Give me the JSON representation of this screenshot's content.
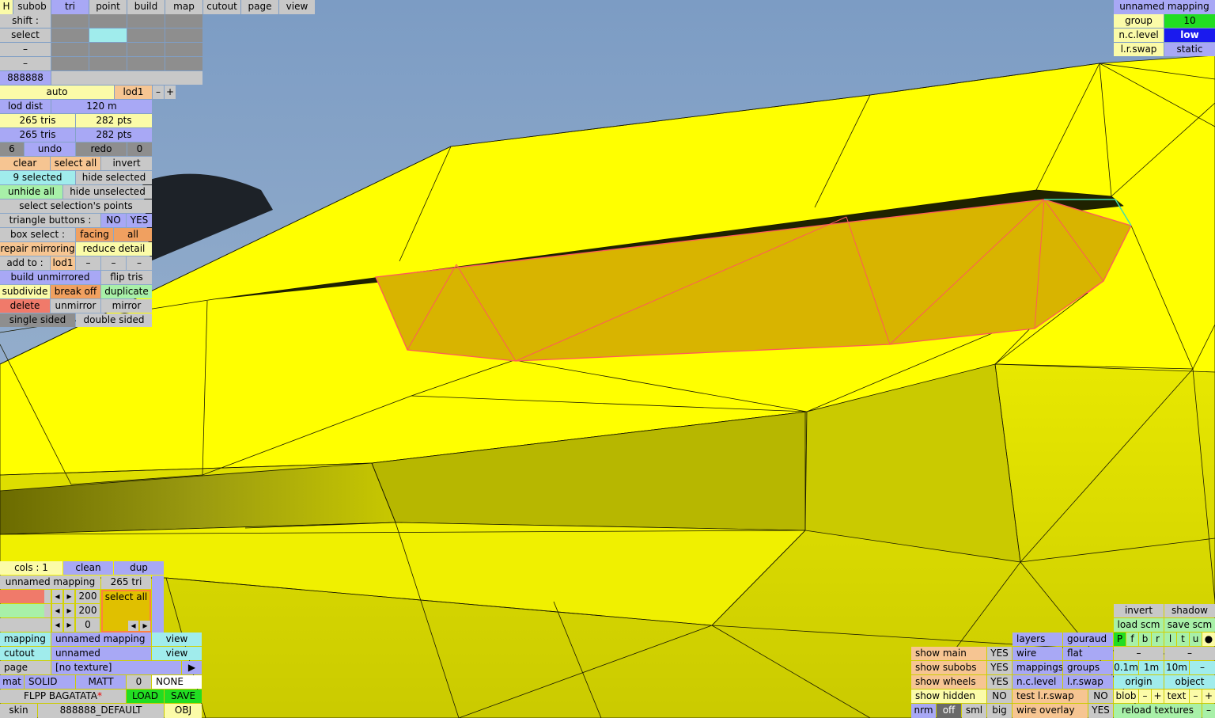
{
  "colors": {
    "mesh": "#ffff00",
    "selection_fill": "#d8b200",
    "selection_edge": "#ff5a5a",
    "highlight_edge": "#44ddaa",
    "sky": "#8fa9c6"
  },
  "top_menu": {
    "h": "H",
    "subob": "subob",
    "tri": "tri",
    "point": "point",
    "build": "build",
    "map": "map",
    "cutout": "cutout",
    "page": "page",
    "view": "view"
  },
  "left": {
    "shift": "shift :",
    "select": "select",
    "dash1": "–",
    "dash2": "–",
    "color": "888888",
    "auto": "auto",
    "lod": "lod1",
    "minus": "–",
    "plus": "+",
    "lod_dist": "lod dist",
    "lod_dist_val": "120 m",
    "tris1": "265 tris",
    "pts1": "282 pts",
    "tris2": "265 tris",
    "pts2": "282 pts",
    "undo_n": "6",
    "undo": "undo",
    "redo": "redo",
    "redo_n": "0",
    "clear": "clear",
    "select_all": "select all",
    "invert": "invert",
    "selected": "9 selected",
    "hide_selected": "hide selected",
    "unhide_all": "unhide all",
    "hide_unselected": "hide unselected",
    "select_points": "select selection's points",
    "triangle_buttons": "triangle buttons :",
    "no": "NO",
    "yes": "YES",
    "box_select": "box select :",
    "facing": "facing",
    "all": "all",
    "repair_mirroring": "repair mirroring",
    "reduce_detail": "reduce detail",
    "add_to": "add to :",
    "add_lod": "lod1",
    "d1": "–",
    "d2": "–",
    "d3": "–",
    "build_unmirrored": "build unmirrored",
    "flip_tris": "flip tris",
    "subdivide": "subdivide",
    "break_off": "break off",
    "duplicate": "duplicate",
    "delete": "delete",
    "unmirror": "unmirror",
    "mirror": "mirror",
    "single_sided": "single sided",
    "double_sided": "double sided"
  },
  "bottom_left": {
    "cols": "cols : 1",
    "clean": "clean",
    "dup": "dup",
    "mapping_name": "unnamed mapping",
    "tri_count": "265 tri",
    "v1": "200",
    "v2": "200",
    "v3": "0",
    "select_all": "select all",
    "mapping": "mapping",
    "mapping_val": "unnamed mapping",
    "view1": "view",
    "cutout": "cutout",
    "cutout_val": "unnamed",
    "view2": "view",
    "page": "page",
    "page_val": "[no texture]",
    "arrow": "▶",
    "mat": "mat",
    "solid": "SOLID",
    "matt": "MATT",
    "mat_n": "0",
    "none": "NONE",
    "file": "FLPP BAGATATA",
    "star": "*",
    "load": "LOAD",
    "save": "SAVE",
    "skin": "skin",
    "skin_val": "888888_DEFAULT",
    "obj": "OBJ"
  },
  "top_right": {
    "title": "unnamed mapping",
    "group": "group",
    "group_val": "10",
    "nc_level": "n.c.level",
    "nc_val": "low",
    "lr_swap": "l.r.swap",
    "lr_val": "static"
  },
  "bottom_right": {
    "invert": "invert",
    "shadow": "shadow",
    "load_scm": "load scm",
    "save_scm": "save scm",
    "flags": [
      "P",
      "f",
      "b",
      "r",
      "l",
      "t",
      "u",
      "●"
    ],
    "show_main": "show main",
    "show_main_v": "YES",
    "show_subobs": "show subobs",
    "show_subobs_v": "YES",
    "show_wheels": "show wheels",
    "show_wheels_v": "YES",
    "show_hidden": "show hidden",
    "show_hidden_v": "NO",
    "nrm": "nrm",
    "off": "off",
    "sml": "sml",
    "big": "big",
    "layers": "layers",
    "gouraud": "gouraud",
    "wire": "wire",
    "flat": "flat",
    "mappings": "mappings",
    "groups": "groups",
    "nclevel": "n.c.level",
    "lrswap": "l.r.swap",
    "test_lr": "test l.r.swap",
    "test_lr_v": "NO",
    "wire_overlay": "wire overlay",
    "wire_overlay_v": "YES",
    "dash1": "–",
    "dash2": "–",
    "s01": "0.1m",
    "s1": "1m",
    "s10": "10m",
    "sdash": "–",
    "origin": "origin",
    "object": "object",
    "blob": "blob",
    "bm": "–",
    "bp": "+",
    "text": "text",
    "tm": "–",
    "tp": "+",
    "reload": "reload textures",
    "rdash": "–"
  }
}
